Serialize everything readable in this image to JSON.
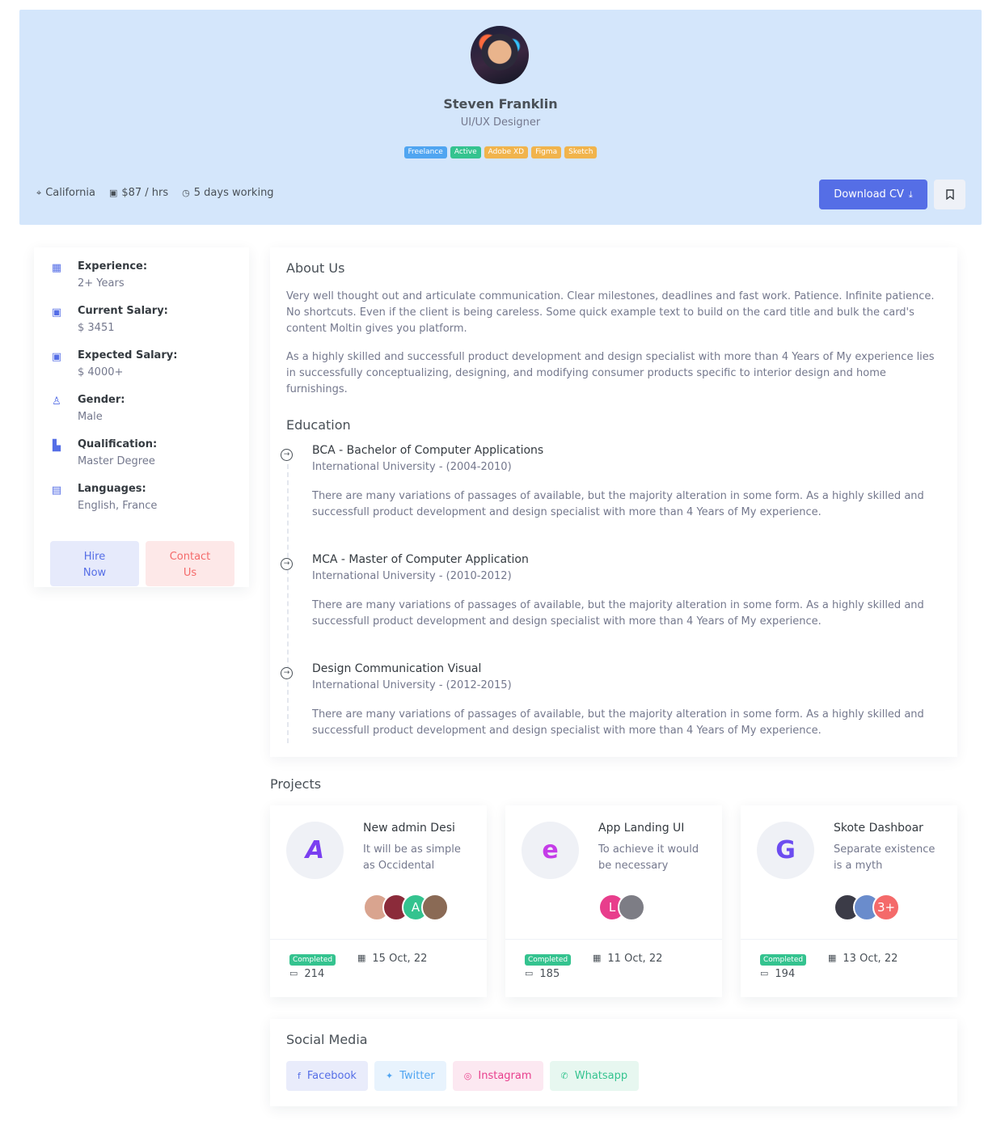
{
  "profile": {
    "name": "Steven Franklin",
    "role": "UI/UX Designer",
    "tags": [
      {
        "label": "Freelance",
        "color": "#50a5f1"
      },
      {
        "label": "Active",
        "color": "#34c38f"
      },
      {
        "label": "Adobe XD",
        "color": "#f1b44c"
      },
      {
        "label": "Figma",
        "color": "#f1b44c"
      },
      {
        "label": "Sketch",
        "color": "#f1b44c"
      }
    ],
    "location": "California",
    "rate": "$87 / hrs",
    "schedule": "5 days working",
    "download_label": "Download CV",
    "icons": {
      "location": "map-pin-icon",
      "rate": "money-icon",
      "schedule": "clock-icon",
      "download": "download-icon",
      "bookmark": "bookmark-icon"
    }
  },
  "sidebar": {
    "items": [
      {
        "label": "Experience:",
        "value": "2+ Years",
        "icon": "calendar-icon"
      },
      {
        "label": "Current Salary:",
        "value": "$ 3451",
        "icon": "money-icon"
      },
      {
        "label": "Expected Salary:",
        "value": "$ 4000+",
        "icon": "money-icon"
      },
      {
        "label": "Gender:",
        "value": "Male",
        "icon": "user-icon"
      },
      {
        "label": "Qualification:",
        "value": "Master Degree",
        "icon": "book-icon"
      },
      {
        "label": "Languages:",
        "value": "English, France",
        "icon": "translate-icon"
      }
    ],
    "hire_label": "Hire Now",
    "contact_label": "Contact Us"
  },
  "about": {
    "title": "About Us",
    "paragraphs": [
      "Very well thought out and articulate communication. Clear milestones, deadlines and fast work. Patience. Infinite patience. No shortcuts. Even if the client is being careless. Some quick example text to build on the card title and bulk the card's content Moltin gives you platform.",
      "As a highly skilled and successfull product development and design specialist with more than 4 Years of My experience lies in successfully conceptualizing, designing, and modifying consumer products specific to interior design and home furnishings."
    ]
  },
  "education": {
    "title": "Education",
    "items": [
      {
        "title": "BCA - Bachelor of Computer Applications",
        "sub": "International University - (2004-2010)",
        "desc": "There are many variations of passages of available, but the majority alteration in some form. As a highly skilled and successfull product development and design specialist with more than 4 Years of My experience."
      },
      {
        "title": "MCA - Master of Computer Application",
        "sub": "International University - (2010-2012)",
        "desc": "There are many variations of passages of available, but the majority alteration in some form. As a highly skilled and successfull product development and design specialist with more than 4 Years of My experience."
      },
      {
        "title": "Design Communication Visual",
        "sub": "International University - (2012-2015)",
        "desc": "There are many variations of passages of available, but the majority alteration in some form. As a highly skilled and successfull product development and design specialist with more than 4 Years of My experience."
      }
    ]
  },
  "projects": {
    "title": "Projects",
    "items": [
      {
        "name": "New admin Desi",
        "desc": "It will be as simple as Occidental",
        "status": "Completed",
        "date": "15 Oct, 22",
        "comments": "214",
        "avatar_text": [
          "",
          "",
          "A",
          ""
        ],
        "avatar_colors": [
          "#d9a48f",
          "#8b2b3a",
          "#34c38f",
          "#8a6a55"
        ]
      },
      {
        "name": "App Landing UI",
        "desc": "To achieve it would be necessary",
        "status": "Completed",
        "date": "11 Oct, 22",
        "comments": "185",
        "avatar_text": [
          "L",
          ""
        ],
        "avatar_colors": [
          "#e83e8c",
          "#7d7d85"
        ]
      },
      {
        "name": "Skote Dashboar",
        "desc": "Separate existence is a myth",
        "status": "Completed",
        "date": "13 Oct, 22",
        "comments": "194",
        "avatar_text": [
          "",
          "",
          "3+"
        ],
        "avatar_colors": [
          "#3b3b47",
          "#6a8ccc",
          "#f46a6a"
        ]
      }
    ]
  },
  "social": {
    "title": "Social Media",
    "links": [
      {
        "label": "Facebook",
        "icon": "facebook-icon",
        "glyph": "f",
        "color": "#556ee6",
        "bg": "#e9ecfb"
      },
      {
        "label": "Twitter",
        "icon": "twitter-icon",
        "glyph": "✦",
        "color": "#50a5f1",
        "bg": "#e8f3fd"
      },
      {
        "label": "Instagram",
        "icon": "instagram-icon",
        "glyph": "◎",
        "color": "#e83e8c",
        "bg": "#fce8f1"
      },
      {
        "label": "Whatsapp",
        "icon": "whatsapp-icon",
        "glyph": "✆",
        "color": "#34c38f",
        "bg": "#e7f7f0"
      }
    ]
  }
}
